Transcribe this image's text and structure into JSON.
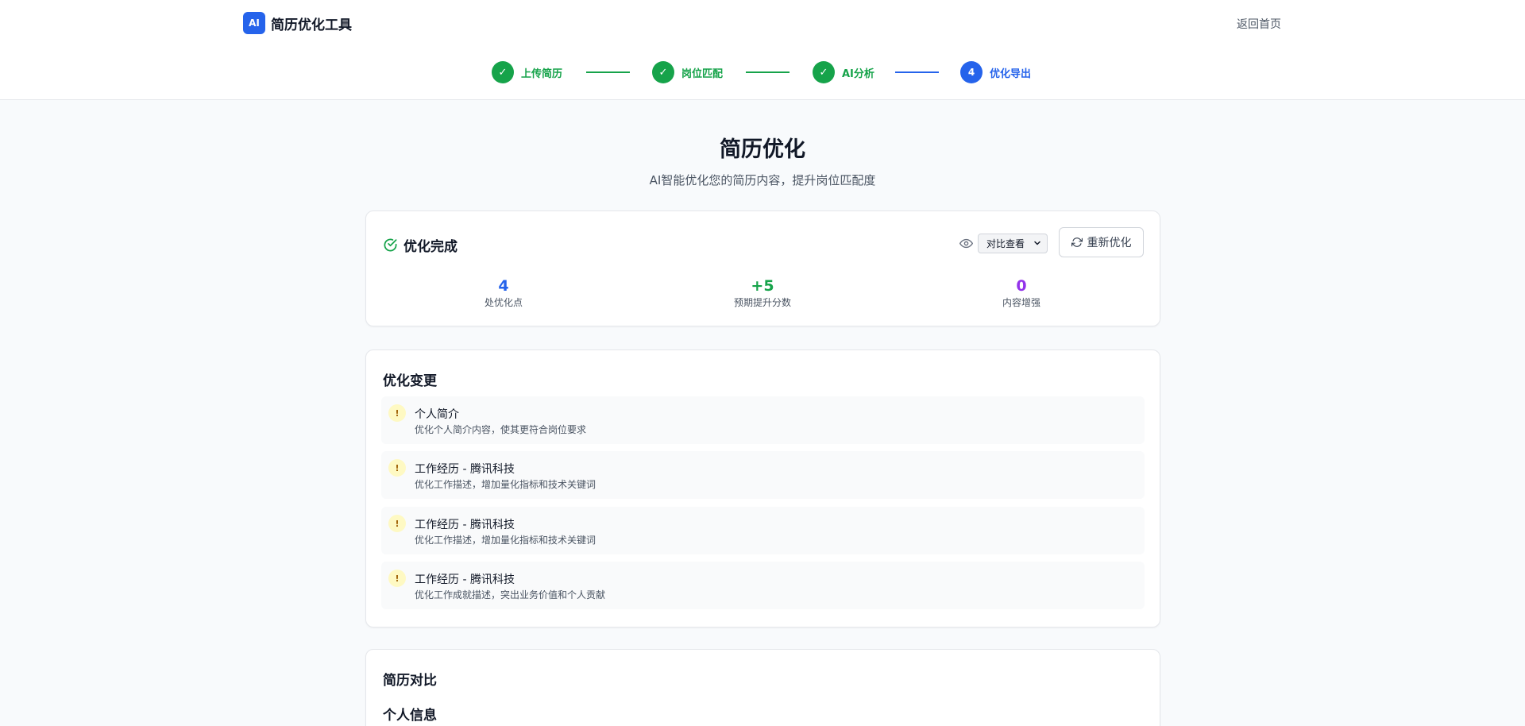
{
  "header": {
    "logo_badge": "AI",
    "app_title": "简历优化工具",
    "back_link": "返回首页"
  },
  "steps": [
    {
      "label": "上传简历",
      "state": "done",
      "marker": "✓"
    },
    {
      "label": "岗位匹配",
      "state": "done",
      "marker": "✓"
    },
    {
      "label": "AI分析",
      "state": "done",
      "marker": "✓"
    },
    {
      "label": "优化导出",
      "state": "active",
      "marker": "4"
    }
  ],
  "page": {
    "title": "简历优化",
    "subtitle": "AI智能优化您的简历内容，提升岗位匹配度"
  },
  "summary": {
    "title": "优化完成",
    "view_mode": {
      "selected": "对比查看"
    },
    "reoptimize_label": "重新优化",
    "stats": [
      {
        "value": "4",
        "label": "处优化点",
        "color": "#2563eb"
      },
      {
        "value": "+5",
        "label": "预期提升分数",
        "color": "#16a34a"
      },
      {
        "value": "0",
        "label": "内容增强",
        "color": "#9333ea"
      }
    ]
  },
  "changes": {
    "title": "优化变更",
    "items": [
      {
        "icon": "!",
        "title": "个人简介",
        "desc": "优化个人简介内容，使其更符合岗位要求"
      },
      {
        "icon": "!",
        "title": "工作经历 - 腾讯科技",
        "desc": "优化工作描述，增加量化指标和技术关键词"
      },
      {
        "icon": "!",
        "title": "工作经历 - 腾讯科技",
        "desc": "优化工作描述，增加量化指标和技术关键词"
      },
      {
        "icon": "!",
        "title": "工作经历 - 腾讯科技",
        "desc": "优化工作成就描述，突出业务价值和个人贡献"
      }
    ]
  },
  "compare": {
    "title": "简历对比",
    "section": "个人信息"
  },
  "colors": {
    "primary": "#2563eb",
    "success": "#16a34a",
    "purple": "#9333ea",
    "warning_bg": "#fef9c3"
  }
}
